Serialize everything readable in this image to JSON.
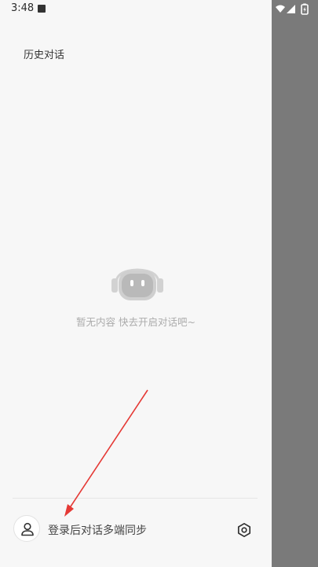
{
  "status_bar": {
    "time": "3:48",
    "icons": [
      "notification-a-icon",
      "wifi-icon",
      "signal-icon",
      "battery-icon"
    ]
  },
  "drawer": {
    "title": "历史对话"
  },
  "empty_state": {
    "icon": "robot-icon",
    "message": "暂无内容 快去开启对话吧~"
  },
  "footer": {
    "login_prompt": "登录后对话多端同步",
    "avatar_icon": "user-icon",
    "settings_icon": "settings-hexagon-icon"
  },
  "colors": {
    "background": "#f7f7f7",
    "scrim": "#7a7a7a",
    "empty_text": "#ababab",
    "annotation": "#e53935"
  }
}
